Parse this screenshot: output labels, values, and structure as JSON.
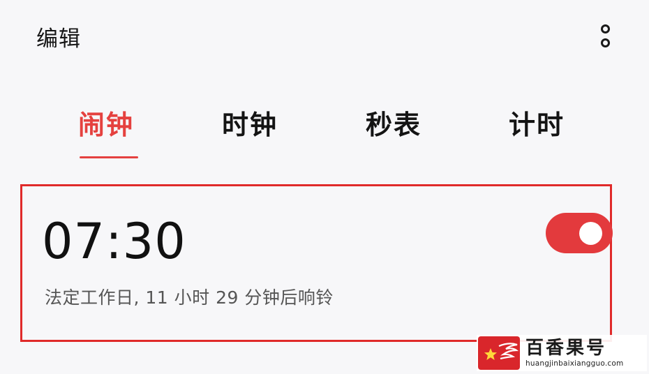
{
  "header": {
    "edit_label": "编辑",
    "more_icon": "more-vertical-icon"
  },
  "tabs": [
    {
      "label": "闹钟",
      "active": true
    },
    {
      "label": "时钟",
      "active": false
    },
    {
      "label": "秒表",
      "active": false
    },
    {
      "label": "计时",
      "active": false
    }
  ],
  "alarm": {
    "time": "07:30",
    "description": "法定工作日, 11 小时 29 分钟后响铃",
    "enabled": true
  },
  "watermark": {
    "title": "百香果号",
    "domain": "huangjinbaixiangguo.com"
  },
  "colors": {
    "accent": "#e5413f",
    "highlight_border": "#e02a2a",
    "background": "#f7f7f9"
  }
}
